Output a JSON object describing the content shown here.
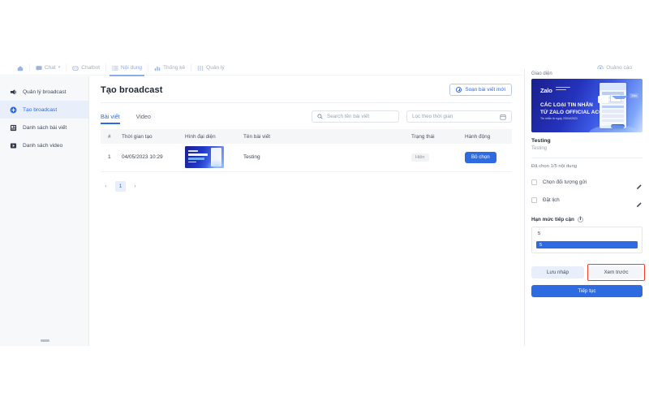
{
  "topnav": {
    "items": [
      {
        "label": "",
        "icon": "home-icon",
        "active": false
      },
      {
        "label": "Chat",
        "icon": "chat-icon",
        "active": false,
        "caret": "▾"
      },
      {
        "label": "Chatbot",
        "icon": "chatbot-icon",
        "active": false
      },
      {
        "label": "Nội dung",
        "icon": "content-list-icon",
        "active": true
      },
      {
        "label": "Thống kê",
        "icon": "bar-chart-icon",
        "active": false
      },
      {
        "label": "Quản lý",
        "icon": "grid-icon",
        "active": false
      }
    ],
    "right": {
      "label": "Quảng cáo",
      "icon": "megaphone-icon"
    }
  },
  "sidebar": {
    "items": [
      {
        "label": "Quản lý broadcast",
        "icon": "broadcast-icon",
        "active": false
      },
      {
        "label": "Tạo broadcast",
        "icon": "plus-circle-icon",
        "active": true
      },
      {
        "label": "Danh sách bài viết",
        "icon": "article-list-icon",
        "active": false
      },
      {
        "label": "Danh sách video",
        "icon": "video-icon",
        "active": false
      }
    ]
  },
  "main": {
    "title": "Tạo broadcast",
    "compose_button": "Soạn bài viết mới",
    "tabs": [
      {
        "label": "Bài viết",
        "active": true
      },
      {
        "label": "Video",
        "active": false
      }
    ],
    "search_placeholder": "Search tên bài viết",
    "date_filter_placeholder": "Lọc theo thời gian",
    "table": {
      "headers": [
        "#",
        "Thời gian tạo",
        "Hình đại diện",
        "Tên bài viết",
        "Trạng thái",
        "Hành động"
      ],
      "rows": [
        {
          "index": "1",
          "created_at": "04/05/2023 10:29",
          "name": "Testing",
          "status": "Hiện",
          "action": "Bỏ chọn"
        }
      ]
    },
    "pagination": {
      "prev": "‹",
      "pages": [
        "1"
      ],
      "next": "›",
      "current": "1"
    }
  },
  "right_panel": {
    "section_label": "Giao diện",
    "banner": {
      "logo": "Zalo",
      "line1": "CÁC LOẠI TIN NHẮN",
      "line2": "TỪ ZALO OFFICIAL ACCOUNT",
      "line3": "Tin nhắn từ ngày 23/04/2021",
      "tag": "Zalo"
    },
    "title": "Testing",
    "subtitle": "Testing",
    "selected_count": "Đã chọn 1/5 nội dung",
    "options": [
      {
        "label": "Chọn đối tượng gửi",
        "checked": false,
        "edit_icon": "pencil-icon"
      },
      {
        "label": "Đặt lịch",
        "checked": false,
        "edit_icon": "pencil-icon"
      }
    ],
    "quota": {
      "label": "Hạn mức tiếp cận",
      "info_icon": "info-icon",
      "value": "5",
      "bar_value": "5"
    },
    "buttons": {
      "draft": "Lưu nháp",
      "preview": "Xem trước",
      "continue": "Tiếp tục"
    }
  },
  "colors": {
    "accent": "#2f6be0",
    "accent_soft": "#e9eefb",
    "highlight": "#ff3b30",
    "sidebar_bg": "#f7f8fa",
    "text": "#39424f"
  }
}
